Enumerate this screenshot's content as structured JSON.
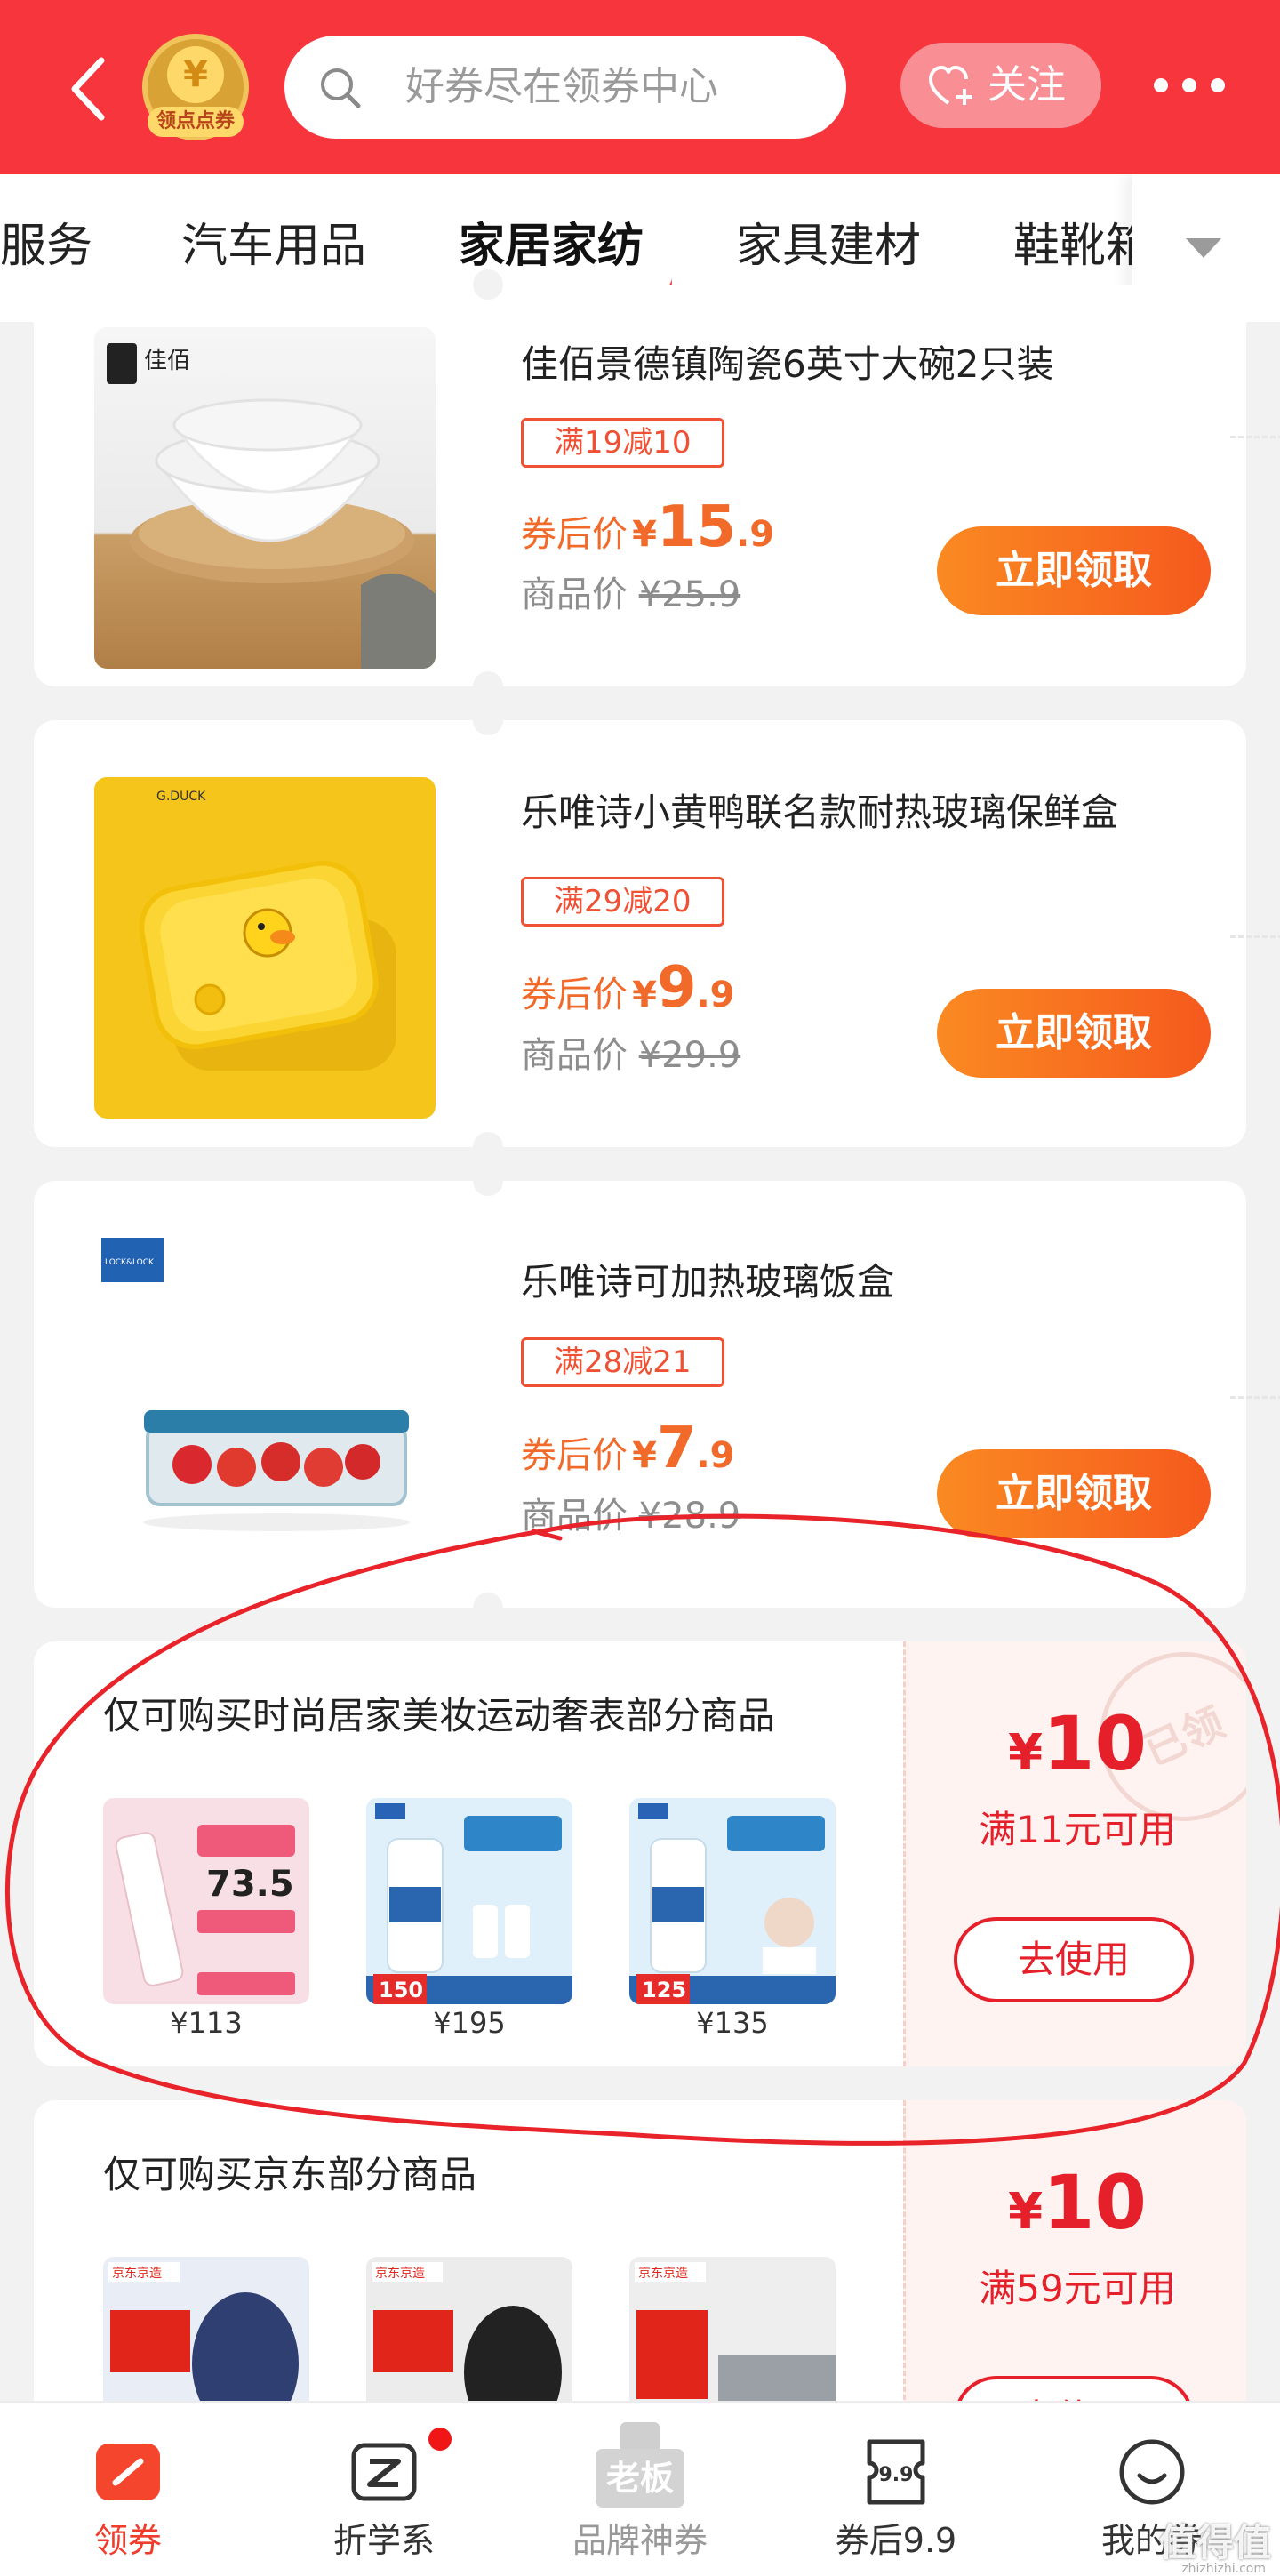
{
  "header": {
    "coin_symbol": "¥",
    "coin_label": "领点点券",
    "search_placeholder": "好券尽在领券中心",
    "follow_label": "关注"
  },
  "tabs": {
    "items": [
      "服务",
      "汽车用品",
      "家居家纺",
      "家具建材",
      "鞋靴箱"
    ],
    "active": "家居家纺"
  },
  "products": [
    {
      "brand": "佳佰",
      "title": "佳佰景德镇陶瓷6英寸大碗2只装",
      "discount": "满19减10",
      "after_label": "券后价",
      "after_currency": "¥",
      "after_int": "15",
      "after_dec": ".9",
      "orig_label": "商品价",
      "orig_price": "¥25.9",
      "button": "立即领取"
    },
    {
      "brand": "G.DUCK",
      "title": "乐唯诗小黄鸭联名款耐热玻璃保鲜盒",
      "discount": "满29减20",
      "after_label": "券后价",
      "after_currency": "¥",
      "after_int": "9",
      "after_dec": ".9",
      "orig_label": "商品价",
      "orig_price": "¥29.9",
      "button": "立即领取"
    },
    {
      "brand": "LOCK&LOCK",
      "title": "乐唯诗可加热玻璃饭盒",
      "discount": "满28减21",
      "after_label": "券后价",
      "after_currency": "¥",
      "after_int": "7",
      "after_dec": ".9",
      "orig_label": "商品价",
      "orig_price": "¥28.9",
      "button": "立即领取"
    }
  ],
  "coupons": [
    {
      "title": "仅可购买时尚居家美妆运动奢表部分商品",
      "thumbs": [
        {
          "label": "73.5",
          "price": "¥113",
          "bg": "#f8dfe6"
        },
        {
          "label": "150",
          "price": "¥195",
          "bg": "#dff0fb"
        },
        {
          "label": "125",
          "price": "¥135",
          "bg": "#dff0fb"
        }
      ],
      "currency": "¥",
      "amount": "10",
      "condition": "满11元可用",
      "button": "去使用",
      "stamp": "已领"
    },
    {
      "title": "仅可购买京东部分商品",
      "thumbs": [
        {
          "label": "京东京造",
          "price": "",
          "bg": "#e9edf5"
        },
        {
          "label": "京东京造",
          "price": "",
          "bg": "#ececec"
        },
        {
          "label": "京东京造",
          "price": "",
          "bg": "#eeeeee"
        }
      ],
      "currency": "¥",
      "amount": "10",
      "condition": "满59元可用",
      "button": "去使用"
    }
  ],
  "bottom_nav": [
    {
      "label": "领券",
      "icon": "coupon-icon",
      "active": true
    },
    {
      "label": "折学系",
      "icon": "z-icon",
      "active": false
    },
    {
      "label": "品牌神券",
      "icon": "boss-icon",
      "active": false
    },
    {
      "label": "券后9.9",
      "icon": "ticket-99-icon",
      "active": false
    },
    {
      "label": "我的券",
      "icon": "smile-icon",
      "active": false
    }
  ],
  "bottom_nav_extra": {
    "boss_text": "老板",
    "ticket_text": "9.9"
  },
  "watermark": "值得值",
  "watermark_sub": "zhizhizhi.com",
  "colors": {
    "header": "#f7353d",
    "accent_orange": "#f26a2a",
    "coupon_red": "#e5202a"
  }
}
